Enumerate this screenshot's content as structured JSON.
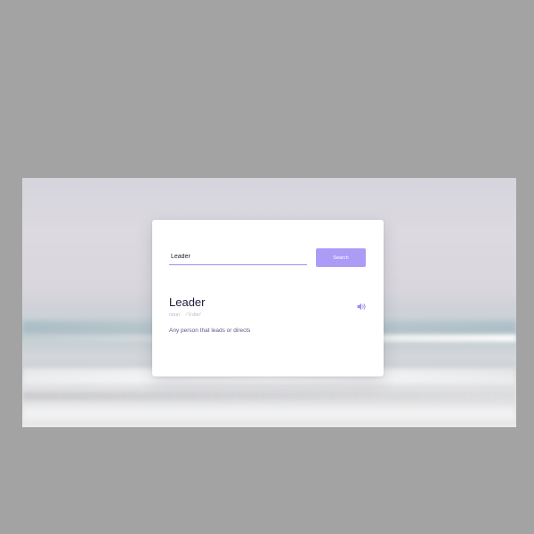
{
  "search": {
    "value": "Leader",
    "button_label": "Search"
  },
  "result": {
    "word": "Leader",
    "part_of_speech": "noun",
    "phonetic": "/ˈliːdər/",
    "definition": "Any person that leads or directs"
  },
  "icons": {
    "pronounce": "speaker-icon"
  },
  "colors": {
    "page_background": "#a3a3a3",
    "accent": "#a38bf5",
    "button": "#ad9cf6",
    "word": "#1d1b3a",
    "definition": "#5c5a80",
    "muted": "#b6b6c2"
  }
}
